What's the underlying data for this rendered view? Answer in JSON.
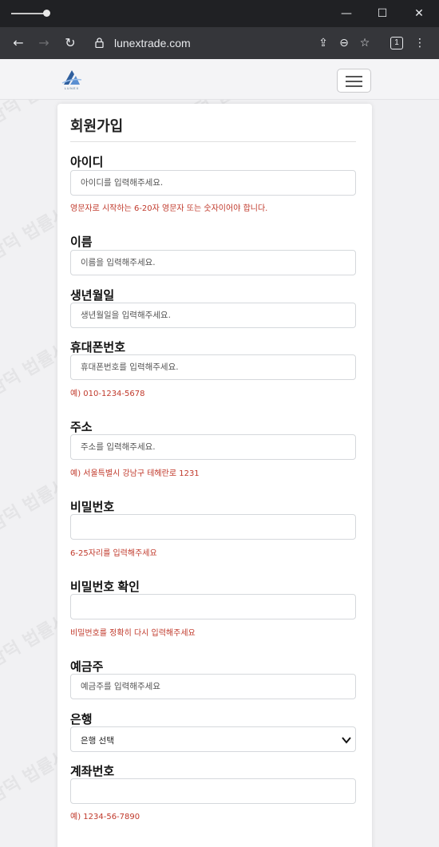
{
  "browser": {
    "url": "lunextrade.com",
    "tab_count": "1"
  },
  "site": {
    "logo_text": "LUNEX"
  },
  "form": {
    "title": "회원가입",
    "fields": {
      "userid": {
        "label": "아이디",
        "placeholder": "아이디를 입력해주세요.",
        "hint": "영문자로 시작하는 6-20자 영문자 또는 숫자이어야 합니다."
      },
      "name": {
        "label": "이름",
        "placeholder": "이름을 입력해주세요."
      },
      "birth": {
        "label": "생년월일",
        "placeholder": "생년월일을 입력해주세요."
      },
      "phone": {
        "label": "휴대폰번호",
        "placeholder": "휴대폰번호를 입력해주세요.",
        "hint": "예) 010-1234-5678"
      },
      "address": {
        "label": "주소",
        "placeholder": "주소를 입력해주세요.",
        "hint": "예) 서울특별시 강남구 테헤란로 1231"
      },
      "password": {
        "label": "비밀번호",
        "placeholder": "",
        "hint": "6-25자리를 입력해주세요"
      },
      "password_confirm": {
        "label": "비밀번호 확인",
        "placeholder": "",
        "hint": "비밀번호를 정확히 다시 입력해주세요"
      },
      "depositor": {
        "label": "예금주",
        "placeholder": "예금주를 입력해주세요"
      },
      "bank": {
        "label": "은행",
        "selected": "은행 선택"
      },
      "account": {
        "label": "계좌번호",
        "placeholder": "",
        "hint": "예) 1234-56-7890"
      }
    }
  },
  "watermark": "담덕 법률사무소",
  "colors": {
    "hint": "#c0392b",
    "chrome_dark": "#202124",
    "chrome_toolbar": "#35363a"
  }
}
